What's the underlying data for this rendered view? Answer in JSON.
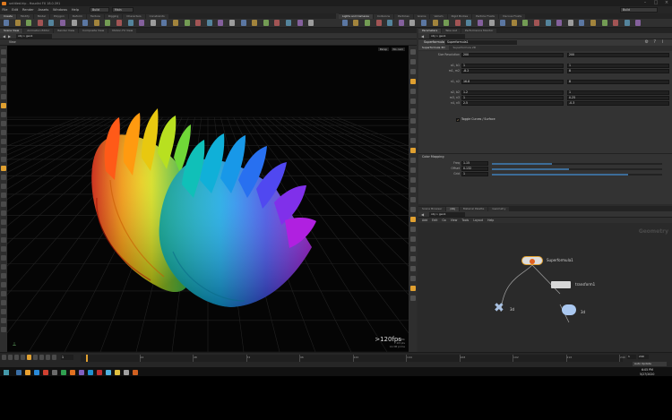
{
  "window": {
    "title": "untitled.hip - Houdini FX 18.0.391"
  },
  "menu": [
    "File",
    "Edit",
    "Render",
    "Assets",
    "Windows",
    "Help"
  ],
  "top_dropdowns": {
    "desktop": "Build",
    "context": "Main"
  },
  "shelf_tabs_left": [
    "Create",
    "Modify",
    "Model",
    "Polygon",
    "Deform",
    "Texture",
    "Rigging",
    "Characters",
    "Constraints",
    "Hair Utils",
    "Guide Process",
    "Terrain FX",
    "Simple FX",
    "Cloud FX",
    "Volume"
  ],
  "shelf_tabs_right": [
    "Lights and Cameras",
    "Collisions",
    "Particles",
    "Grains",
    "Vellum",
    "Rigid Bodies",
    "Particle Fluids",
    "Viscous Fluids",
    "Oceans",
    "Fluid Containers",
    "Populate Containers",
    "Container Tools",
    "Pyro FX",
    "Sparse Pyro FX",
    "FEM",
    "Wires",
    "Crowds",
    "Drive Simulation"
  ],
  "pane_tabs_left": [
    "Scene View",
    "Animation Editor",
    "Render View",
    "Composite View",
    "Motion FX View"
  ],
  "pane_tabs_right": [
    "Parameters",
    "Take List",
    "Performance Monitor"
  ],
  "viewport": {
    "path": "obj > geo1",
    "view_label": "View",
    "persp_label": "Persp",
    "cam_label": "No cam",
    "fps": ">120fps",
    "stats": [
      "1.8Mk",
      "7.1M pts",
      "14.3M prims"
    ]
  },
  "params": {
    "node_title": "Superformula",
    "node_name": "Superformula1",
    "tabs": [
      "Superformula 3D",
      "Superformula 2D"
    ],
    "rows": [
      {
        "label": "Size Resolution",
        "values": [
          "200",
          "200"
        ]
      },
      {
        "label": "a1, b1",
        "values": [
          "1",
          "1"
        ]
      },
      {
        "label": "m1, m2",
        "values": [
          "-8.2",
          "8"
        ]
      },
      {
        "label": "n1, n2",
        "values": [
          "16.8",
          "8"
        ]
      },
      {
        "label": "a2, b2",
        "values": [
          "1.2",
          "1"
        ]
      },
      {
        "label": "m3, n3",
        "values": [
          "1",
          "0.25"
        ]
      },
      {
        "label": "n4, n5",
        "values": [
          "2.5",
          "-0.3"
        ]
      }
    ],
    "toggle_label": "Toggle Curves / Surface",
    "color_section": "Color Mapping",
    "color_rows": [
      {
        "label": "Freq",
        "value": "1.15",
        "fill": 0.35
      },
      {
        "label": "Offset",
        "value": "0.132",
        "fill": 0.45
      },
      {
        "label": "Grid",
        "value": "1",
        "fill": 0.8
      }
    ]
  },
  "network": {
    "tabs": [
      "Scene Browser",
      "/obj",
      "Material Palette",
      "Geometry"
    ],
    "path": "obj > geo1",
    "menu": [
      "Add",
      "Edit",
      "Go",
      "View",
      "Tools",
      "Layout",
      "Help"
    ],
    "context_label": "Geometry",
    "nodes": [
      {
        "name": "Superformula1",
        "type": "Superformula"
      },
      {
        "name": "transform1",
        "type": "xform"
      },
      {
        "name": "3d",
        "type": "null"
      },
      {
        "name": "3d",
        "type": "object_merge"
      }
    ]
  },
  "timeline": {
    "frame": "1",
    "start": "1",
    "end": "240",
    "ticks": [
      "24",
      "48",
      "72",
      "96",
      "120",
      "144",
      "168",
      "192",
      "216",
      "240"
    ],
    "auto_update": "Auto Update"
  },
  "taskbar": {
    "time": "6:05 PM",
    "date": "5/27/2020"
  },
  "colors": {
    "accent_orange": "#e0a030",
    "background": "#2b2b2b",
    "viewport": "#050505"
  }
}
